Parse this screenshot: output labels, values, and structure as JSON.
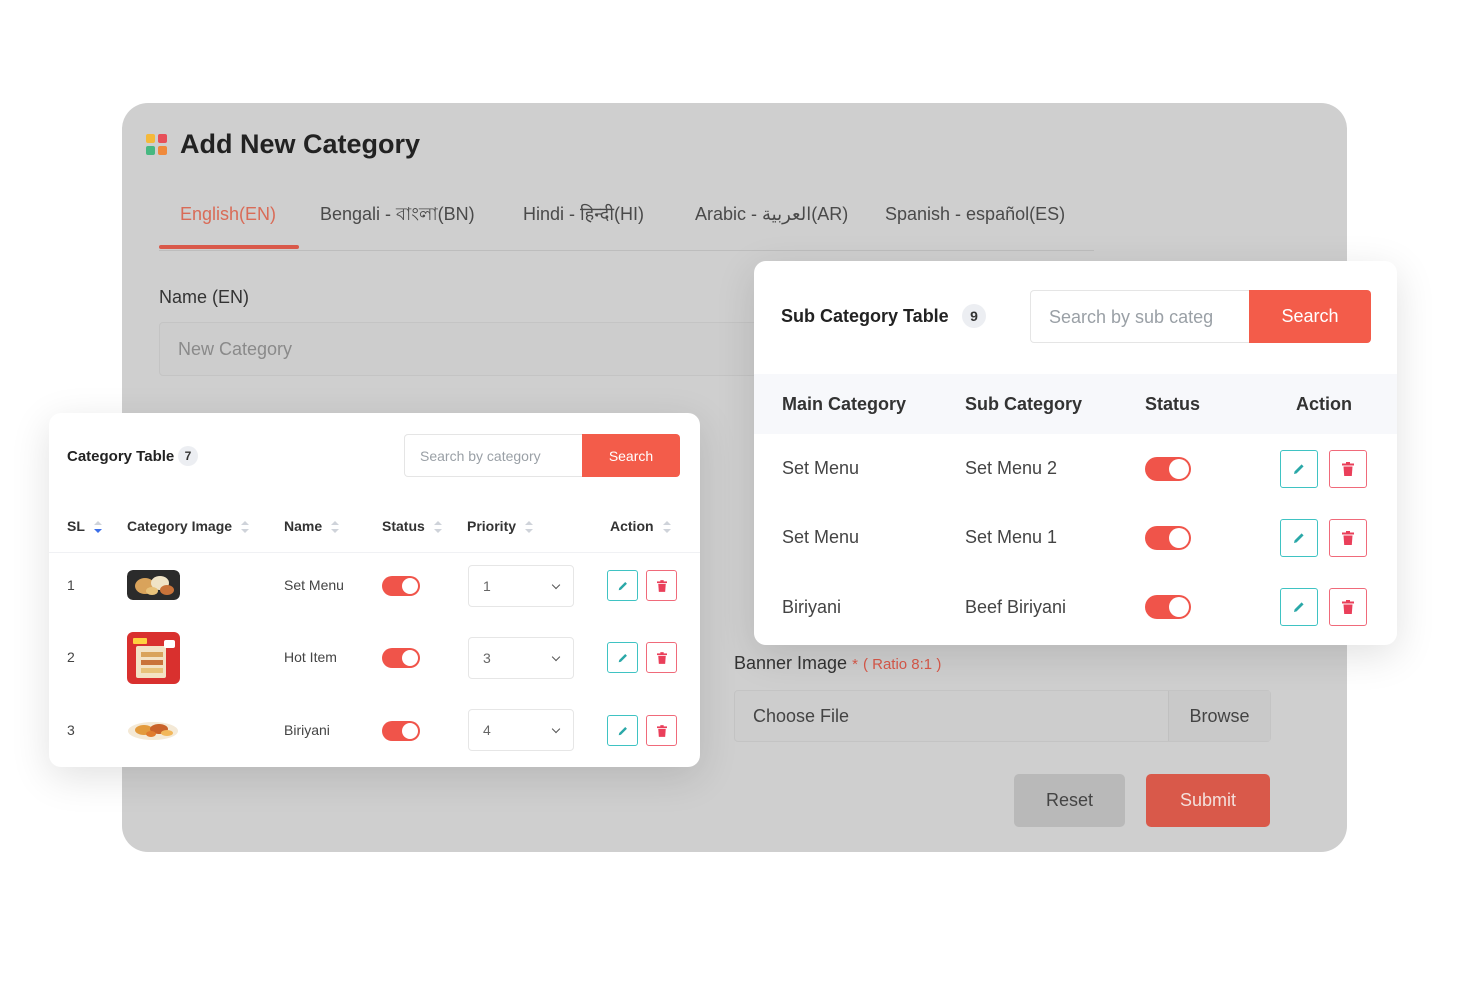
{
  "form": {
    "title": "Add New Category",
    "tabs": [
      {
        "label": "English(EN)",
        "active": true
      },
      {
        "label": "Bengali - বাংলা(BN)",
        "active": false
      },
      {
        "label": "Hindi - हिन्दी(HI)",
        "active": false
      },
      {
        "label": "Arabic - العربية(AR)",
        "active": false
      },
      {
        "label": "Spanish - español(ES)",
        "active": false
      }
    ],
    "name_label": "Name (EN)",
    "name_placeholder": "New Category",
    "banner_label": "Banner Image",
    "banner_required": "*",
    "banner_ratio": "( Ratio 8:1 )",
    "file_text": "Choose File",
    "browse_label": "Browse",
    "reset_label": "Reset",
    "submit_label": "Submit"
  },
  "category_table": {
    "title": "Category Table",
    "count": "7",
    "search_placeholder": "Search by category",
    "search_label": "Search",
    "headers": [
      "SL",
      "Category Image",
      "Name",
      "Status",
      "Priority",
      "Action"
    ],
    "rows": [
      {
        "sl": "1",
        "name": "Set Menu",
        "status_on": true,
        "priority": "1"
      },
      {
        "sl": "2",
        "name": "Hot Item",
        "status_on": true,
        "priority": "3"
      },
      {
        "sl": "3",
        "name": "Biriyani",
        "status_on": true,
        "priority": "4"
      }
    ]
  },
  "sub_category_table": {
    "title": "Sub Category Table",
    "count": "9",
    "search_placeholder": "Search by sub categ",
    "search_label": "Search",
    "headers": [
      "Main Category",
      "Sub Category",
      "Status",
      "Action"
    ],
    "rows": [
      {
        "main": "Set Menu",
        "sub": "Set Menu 2",
        "status_on": true
      },
      {
        "main": "Set Menu",
        "sub": "Set Menu 1",
        "status_on": true
      },
      {
        "main": "Biriyani",
        "sub": "Beef Biriyani",
        "status_on": true
      }
    ]
  },
  "colors": {
    "accent": "#f35c4a",
    "edit": "#3fc3c3",
    "delete": "#f06a7a"
  }
}
